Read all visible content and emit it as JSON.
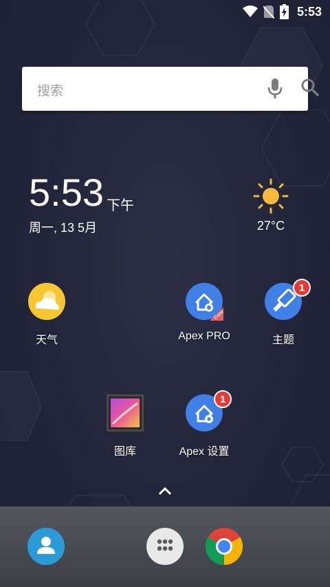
{
  "status_bar": {
    "time": "5:53",
    "icons": [
      "wifi-icon",
      "no-sim-icon",
      "battery-charging-icon"
    ]
  },
  "search": {
    "placeholder": "搜索",
    "icons": [
      "mic-icon",
      "search-icon"
    ]
  },
  "clock": {
    "time": "5:53",
    "ampm": "下午",
    "date": "周一, 13 5月"
  },
  "weather": {
    "icon": "sun-icon",
    "temperature": "27°C"
  },
  "apps": [
    {
      "label": "天气",
      "icon": "weather-app-icon",
      "badge": ""
    },
    {
      "label": "Apex PRO",
      "icon": "apex-pro-icon",
      "badge": ""
    },
    {
      "label": "主题",
      "icon": "theme-brush-icon",
      "badge": "1"
    },
    {
      "label": "图库",
      "icon": "gallery-icon",
      "badge": ""
    },
    {
      "label": "Apex 设置",
      "icon": "apex-settings-icon",
      "badge": "1"
    }
  ],
  "drawer_handle": {
    "icon": "chevron-up-icon"
  },
  "dock": {
    "apps": [
      {
        "icon": "contacts-icon"
      },
      {
        "icon": "app-drawer-icon"
      },
      {
        "icon": "chrome-icon"
      }
    ]
  },
  "colors": {
    "wallpaper": "#23263a",
    "apex_blue": "#3f7fe6",
    "badge_red": "#e53935",
    "sun": "#f6b93b",
    "dock": "#4a4c54"
  }
}
